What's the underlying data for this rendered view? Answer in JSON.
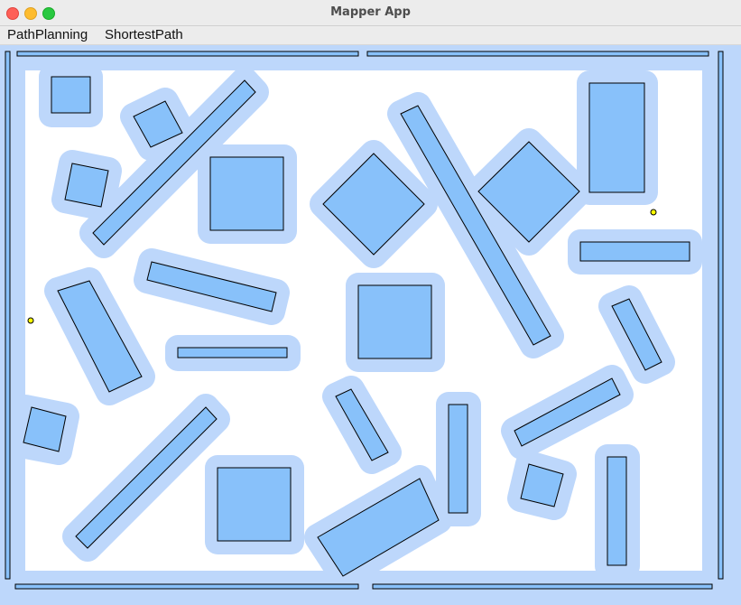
{
  "window": {
    "title": "Mapper App",
    "traffic_lights": {
      "close_color": "#fe5f57",
      "minimize_color": "#febc2e",
      "maximize_color": "#28c840"
    }
  },
  "menu": {
    "items": [
      "PathPlanning",
      "ShortestPath"
    ]
  },
  "map": {
    "obstacle_fill": "#88c1fa",
    "inflation_fill": "#bdd7fb",
    "outline_color": "#000000",
    "point_fill": "#ffff00",
    "point_count": 2
  }
}
